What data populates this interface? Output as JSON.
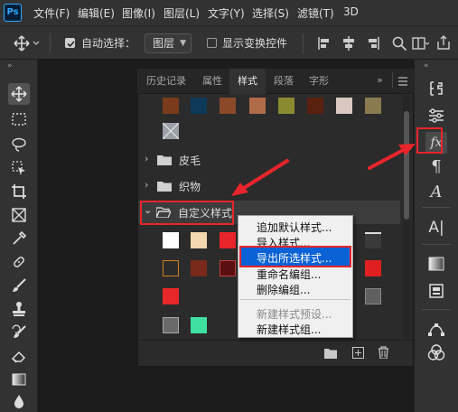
{
  "menubar": {
    "logo": "Ps",
    "items": [
      "文件(F)",
      "编辑(E)",
      "图像(I)",
      "图层(L)",
      "文字(Y)",
      "选择(S)",
      "滤镜(T)",
      "3D"
    ]
  },
  "options": {
    "auto_select_label": "自动选择：",
    "auto_select_checked": true,
    "layer_dropdown": "图层",
    "show_transform_label": "显示变换控件",
    "show_transform_checked": false
  },
  "panel": {
    "tabs": [
      "历史记录",
      "属性",
      "样式",
      "段落",
      "字形"
    ],
    "active_tab": "样式",
    "groups": [
      {
        "label": "皮毛",
        "expanded": false
      },
      {
        "label": "织物",
        "expanded": false
      },
      {
        "label": "自定义样式",
        "expanded": true
      }
    ]
  },
  "context_menu": {
    "items": [
      {
        "label": "追加默认样式...",
        "disabled": false,
        "highlighted": false
      },
      {
        "label": "导入样式...",
        "disabled": false,
        "highlighted": false
      },
      {
        "label": "导出所选样式...",
        "disabled": false,
        "highlighted": true
      },
      {
        "label": "重命名编组...",
        "disabled": false,
        "highlighted": false
      },
      {
        "label": "删除编组...",
        "disabled": false,
        "highlighted": false
      },
      {
        "label": "新建样式预设...",
        "disabled": true,
        "highlighted": false
      },
      {
        "label": "新建样式组...",
        "disabled": false,
        "highlighted": false
      }
    ]
  },
  "right_strip": {
    "fx_label": "fx"
  },
  "colors": {
    "highlight_red": "#e8252b",
    "menu_highlight": "#0a62d6",
    "panel_bg": "#2b2b2b"
  }
}
